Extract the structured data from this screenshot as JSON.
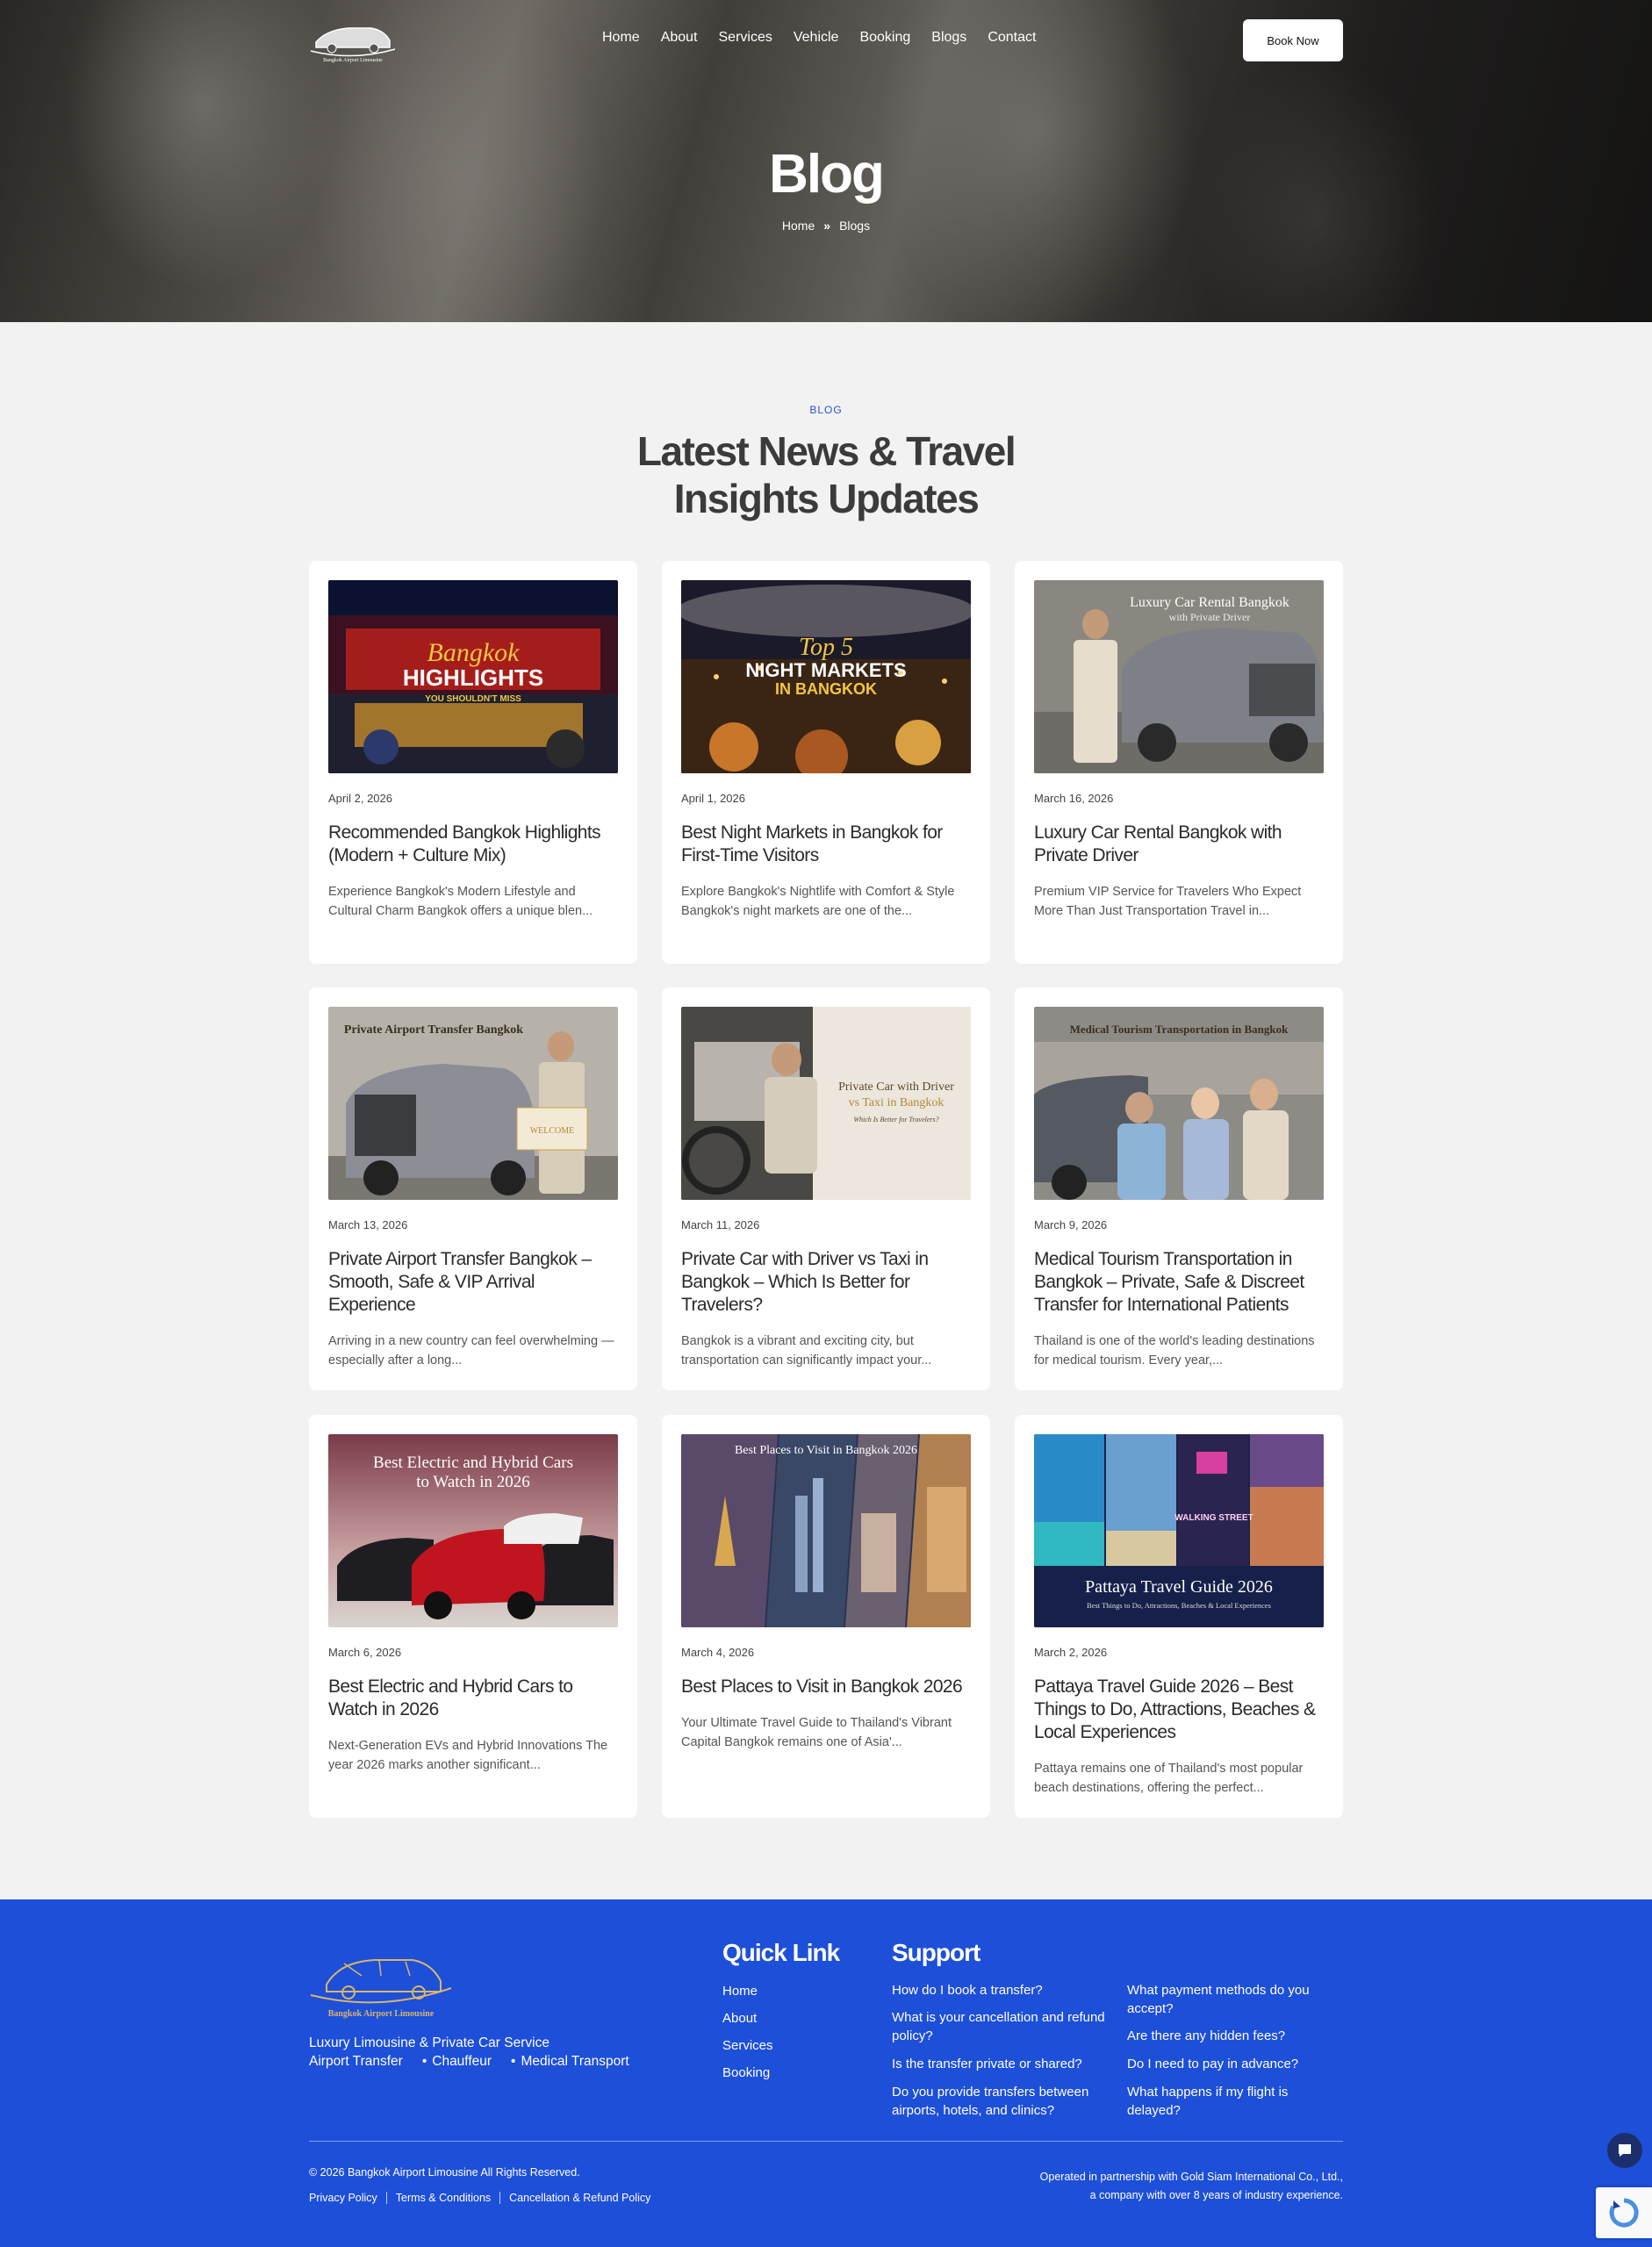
{
  "header": {
    "logo_text": "Bangkok Airport Limousine",
    "nav": [
      "Home",
      "About",
      "Services",
      "Vehicle",
      "Booking",
      "Blogs",
      "Contact"
    ],
    "book_label": "Book Now"
  },
  "hero": {
    "title": "Blog",
    "breadcrumb": [
      "Home",
      "Blogs"
    ]
  },
  "section": {
    "eyebrow": "BLOG",
    "title_line1": "Latest News & Travel",
    "title_line2": "Insights Updates"
  },
  "posts": [
    {
      "date": "April 2, 2026",
      "title": "Recommended Bangkok Highlights (Modern + Culture Mix)",
      "excerpt": "Experience Bangkok's Modern Lifestyle and Cultural Charm Bangkok offers a unique blen...",
      "image_text": [
        "Bangkok",
        "HIGHLIGHTS",
        "YOU SHOULDN'T MISS"
      ]
    },
    {
      "date": "April 1, 2026",
      "title": "Best Night Markets in Bangkok for First-Time Visitors",
      "excerpt": "Explore Bangkok's Nightlife with Comfort & Style Bangkok's night markets are one of the...",
      "image_text": [
        "Top 5",
        "NIGHT MARKETS",
        "IN BANGKOK"
      ]
    },
    {
      "date": "March 16, 2026",
      "title": "Luxury Car Rental Bangkok with Private Driver",
      "excerpt": "Premium VIP Service for Travelers Who Expect More Than Just Transportation Travel in...",
      "image_text": [
        "Luxury Car Rental Bangkok",
        "with Private Driver"
      ]
    },
    {
      "date": "March 13, 2026",
      "title": "Private Airport Transfer Bangkok – Smooth, Safe & VIP Arrival Experience",
      "excerpt": "Arriving in a new country can feel overwhelming — especially after a long...",
      "image_text": [
        "Private Airport Transfer Bangkok",
        "WELCOME"
      ]
    },
    {
      "date": "March 11, 2026",
      "title": "Private Car with Driver vs Taxi in Bangkok – Which Is Better for Travelers?",
      "excerpt": "Bangkok is a vibrant and exciting city, but transportation can significantly impact your...",
      "image_text": [
        "Private Car with Driver",
        "vs Taxi in Bangkok",
        "Which Is Better for Travelers?"
      ]
    },
    {
      "date": "March 9, 2026",
      "title": "Medical Tourism Transportation in Bangkok – Private, Safe & Discreet Transfer for International Patients",
      "excerpt": "Thailand is one of the world's leading destinations for medical tourism. Every year,...",
      "image_text": [
        "Medical Tourism Transportation in Bangkok"
      ]
    },
    {
      "date": "March 6, 2026",
      "title": "Best Electric and Hybrid Cars to Watch in 2026",
      "excerpt": "Next-Generation EVs and Hybrid Innovations The year 2026 marks another significant...",
      "image_text": [
        "Best Electric and Hybrid Cars",
        "to Watch in 2026"
      ]
    },
    {
      "date": "March 4, 2026",
      "title": "Best Places to Visit in Bangkok 2026",
      "excerpt": "Your Ultimate Travel Guide to Thailand's Vibrant Capital Bangkok remains one of Asia'...",
      "image_text": [
        "Best Places to Visit in Bangkok 2026"
      ]
    },
    {
      "date": "March 2, 2026",
      "title": "Pattaya Travel Guide 2026 – Best Things to Do, Attractions, Beaches & Local Experiences",
      "excerpt": "Pattaya remains one of Thailand's most popular beach destinations, offering the perfect...",
      "image_text": [
        "Pattaya Travel Guide 2026",
        "Best Things to Do, Attractions, Beaches & Local Experiences",
        "WALKING STREET"
      ]
    }
  ],
  "footer": {
    "logo_text": "Bangkok Airport Limousine",
    "tagline": "Luxury Limousine & Private Car Service",
    "services": [
      "Airport Transfer",
      "Chauffeur",
      "Medical Transport"
    ],
    "quick_link_heading": "Quick Link",
    "quick_links": [
      "Home",
      "About",
      "Services",
      "Booking"
    ],
    "support_heading": "Support",
    "faq_col1": [
      "How do I book a transfer?",
      "What is your cancellation and refund policy?",
      "Is the transfer private or shared?",
      "Do you provide transfers between airports, hotels, and clinics?"
    ],
    "faq_col2": [
      "What payment methods do you accept?",
      "Are there any hidden fees?",
      "Do I need to pay in advance?",
      "What happens if my flight is delayed?"
    ],
    "copyright": "© 2026 Bangkok Airport Limousine All Rights Reserved.",
    "legal": [
      "Privacy Policy",
      "Terms & Conditions",
      "Cancellation & Refund Policy"
    ],
    "partner_line1": "Operated in partnership with Gold Siam International Co., Ltd.,",
    "partner_line2": "a company with over 8 years of industry experience."
  },
  "colors": {
    "brand_blue": "#1d4fd8",
    "accent_blue": "#2a4fd6",
    "gold": "#d9b56a"
  }
}
